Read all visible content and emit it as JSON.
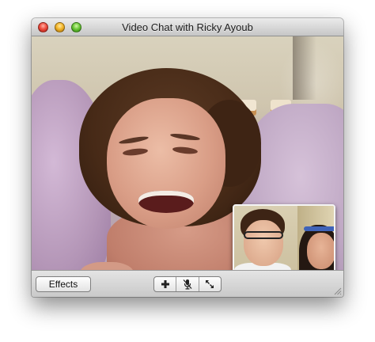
{
  "window": {
    "title": "Video Chat with Ricky Ayoub"
  },
  "titlebar": {
    "buttons": [
      {
        "name": "close",
        "color": "#ef4e3f"
      },
      {
        "name": "minimize",
        "color": "#f3b62b"
      },
      {
        "name": "zoom",
        "color": "#6cc839"
      }
    ]
  },
  "main_video": {
    "participant": "remote"
  },
  "self_view": {
    "participant": "local"
  },
  "toolbar": {
    "effects_label": "Effects",
    "controls": [
      {
        "icon": "plus-icon"
      },
      {
        "icon": "mute-microphone-icon"
      },
      {
        "icon": "fullscreen-icon"
      }
    ]
  }
}
